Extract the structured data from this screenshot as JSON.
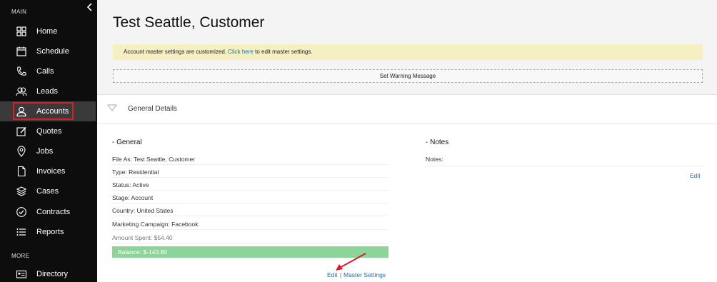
{
  "sidebar": {
    "main_label": "MAIN",
    "more_label": "MORE",
    "items": [
      {
        "label": "Home",
        "icon": "home-icon"
      },
      {
        "label": "Schedule",
        "icon": "calendar-icon"
      },
      {
        "label": "Calls",
        "icon": "phone-icon"
      },
      {
        "label": "Leads",
        "icon": "leads-icon"
      },
      {
        "label": "Accounts",
        "icon": "user-icon"
      },
      {
        "label": "Quotes",
        "icon": "edit-icon"
      },
      {
        "label": "Jobs",
        "icon": "location-pin-icon"
      },
      {
        "label": "Invoices",
        "icon": "document-icon"
      },
      {
        "label": "Cases",
        "icon": "layers-icon"
      },
      {
        "label": "Contracts",
        "icon": "check-circle-icon"
      },
      {
        "label": "Reports",
        "icon": "list-icon"
      },
      {
        "label": "Directory",
        "icon": "id-card-icon"
      }
    ],
    "active_item": "Accounts",
    "highlight_color": "#e0192b"
  },
  "header": {
    "title": "Test Seattle, Customer",
    "notice_text": "Account master settings are customized.",
    "notice_link": "Click here",
    "notice_suffix": "to edit master settings.",
    "warning_button": "Set Warning Message"
  },
  "general_details": {
    "title": "General Details",
    "general": {
      "heading": "- General",
      "fields": [
        "File As: Test Seattle, Customer",
        "Type: Residential",
        "Status: Active",
        "Stage: Account",
        "Country: United States",
        "Marketing Campaign: Facebook",
        "Amount Spent: $54.40"
      ],
      "balance": "Balance: $-143.80",
      "balance_color": "#8dd49b",
      "edit_link": "Edit",
      "separator": "|",
      "master_link": "Master Settings"
    },
    "notes": {
      "heading": "- Notes",
      "label": "Notes:",
      "edit_link": "Edit"
    }
  }
}
